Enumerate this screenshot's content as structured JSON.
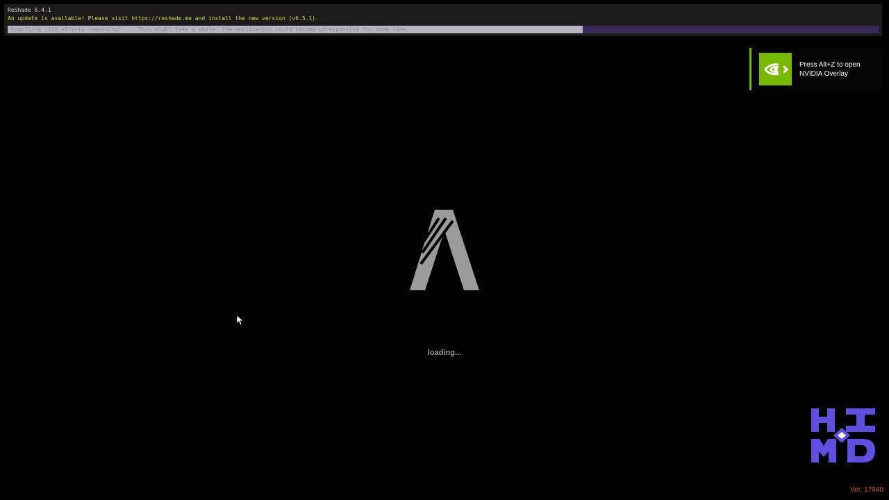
{
  "reshade": {
    "title": "ReShade 6.4.1",
    "update_message": "An update is available! Please visit https://reshade.me and install the new version (v6.5.1).",
    "compile_status": "Compiling (168 effects remaining) ... This might take a while. The application could become unresponsive for some time.",
    "progress_fraction": 0.66,
    "progress_color": "#b7b4c2",
    "track_color": "#3a2a5a"
  },
  "nvidia_overlay": {
    "message": "Press Alt+Z to open NVIDIA Overlay",
    "icon": "nvidia-eye-icon",
    "accent_color": "#76b900"
  },
  "game": {
    "logo_icon": "game-logo-icon",
    "loading_text": "loading...",
    "version_text": "Ver. 17940"
  },
  "watermark": {
    "icon": "watermark-logo-icon",
    "color": "#5f4fe0"
  },
  "cursor": {
    "icon": "mouse-pointer-icon"
  }
}
